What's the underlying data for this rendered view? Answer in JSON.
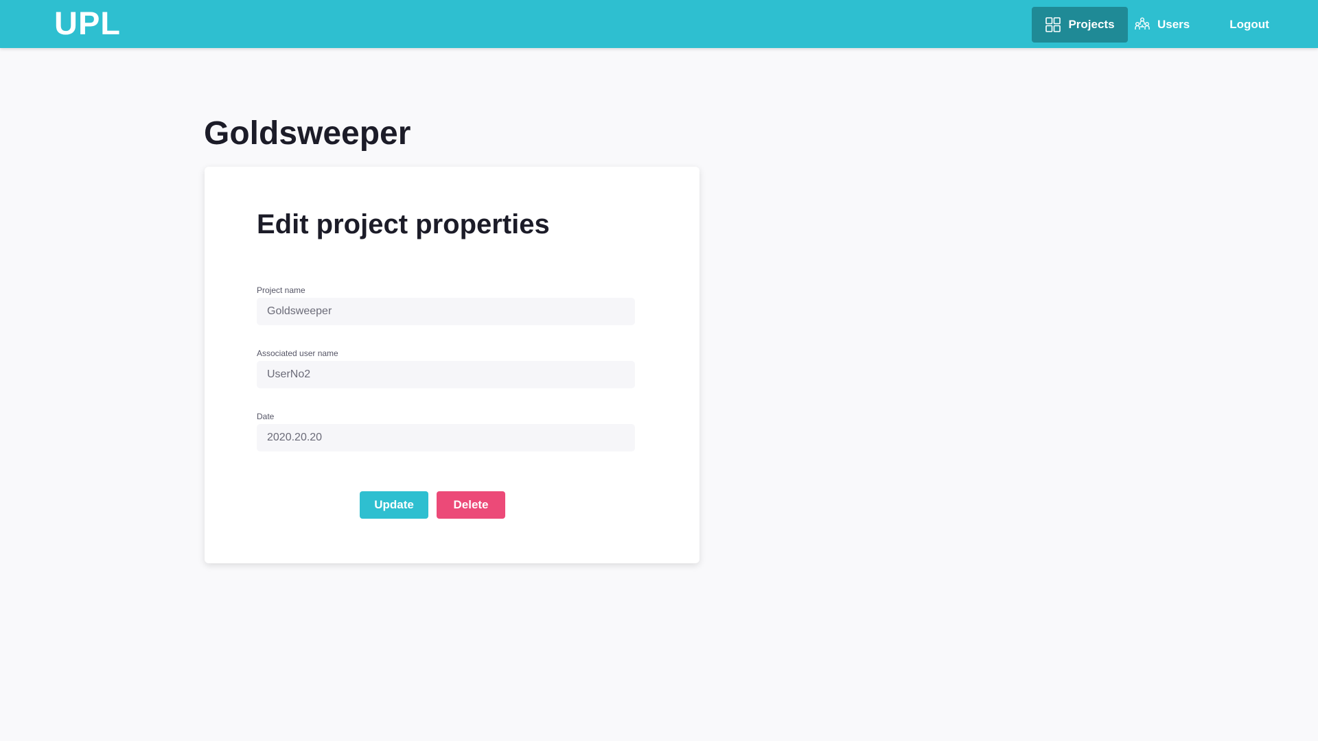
{
  "app": {
    "logo": "UPL"
  },
  "nav": {
    "projects": "Projects",
    "users": "Users",
    "logout": "Logout",
    "active": "Projects"
  },
  "page": {
    "title": "Goldsweeper"
  },
  "form": {
    "title": "Edit project properties",
    "fields": [
      {
        "label": "Project name",
        "value": "Goldsweeper"
      },
      {
        "label": "Associated user name",
        "value": "UserNo2"
      },
      {
        "label": "Date",
        "value": "2020.20.20"
      }
    ],
    "update_label": "Update",
    "delete_label": "Delete"
  },
  "colors": {
    "brand": "#2ebfd0",
    "nav_active": "#1f8a96",
    "danger": "#ec4a78",
    "background": "#f9f9fb"
  },
  "icons": {
    "projects": "grid-icon",
    "users": "users-icon"
  }
}
